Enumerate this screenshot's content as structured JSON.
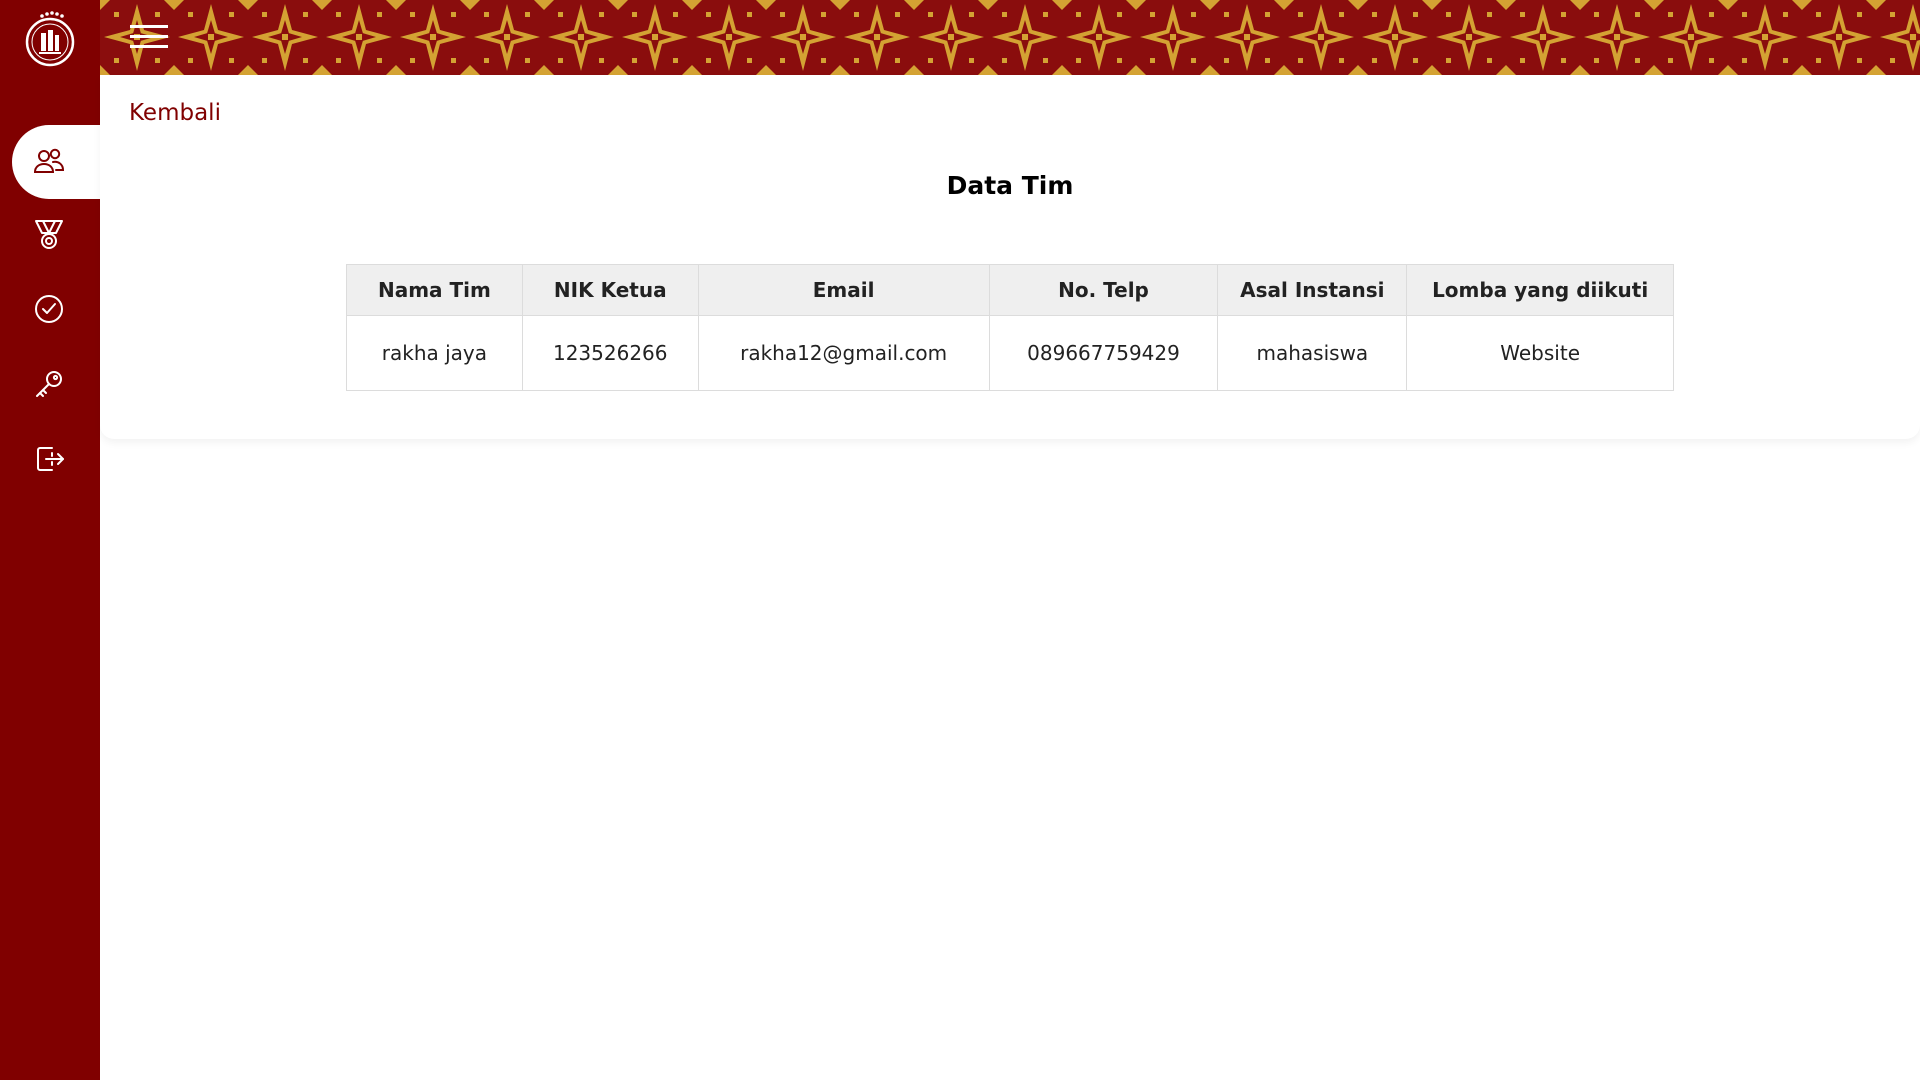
{
  "colors": {
    "brand": "#800000",
    "accent_gold": "#d4a233",
    "header_bg": "#efefef"
  },
  "sidebar": {
    "items": [
      {
        "icon": "users-icon",
        "active": true
      },
      {
        "icon": "medal-icon",
        "active": false
      },
      {
        "icon": "check-circle-icon",
        "active": false
      },
      {
        "icon": "key-icon",
        "active": false
      },
      {
        "icon": "logout-icon",
        "active": false
      }
    ]
  },
  "nav": {
    "back_label": "Kembali"
  },
  "page": {
    "title": "Data Tim"
  },
  "table": {
    "headers": [
      "Nama Tim",
      "NIK Ketua",
      "Email",
      "No. Telp",
      "Asal Instansi",
      "Lomba yang diikuti"
    ],
    "rows": [
      [
        "rakha jaya",
        "123526266",
        "rakha12@gmail.com",
        "089667759429",
        "mahasiswa",
        "Website"
      ]
    ]
  }
}
